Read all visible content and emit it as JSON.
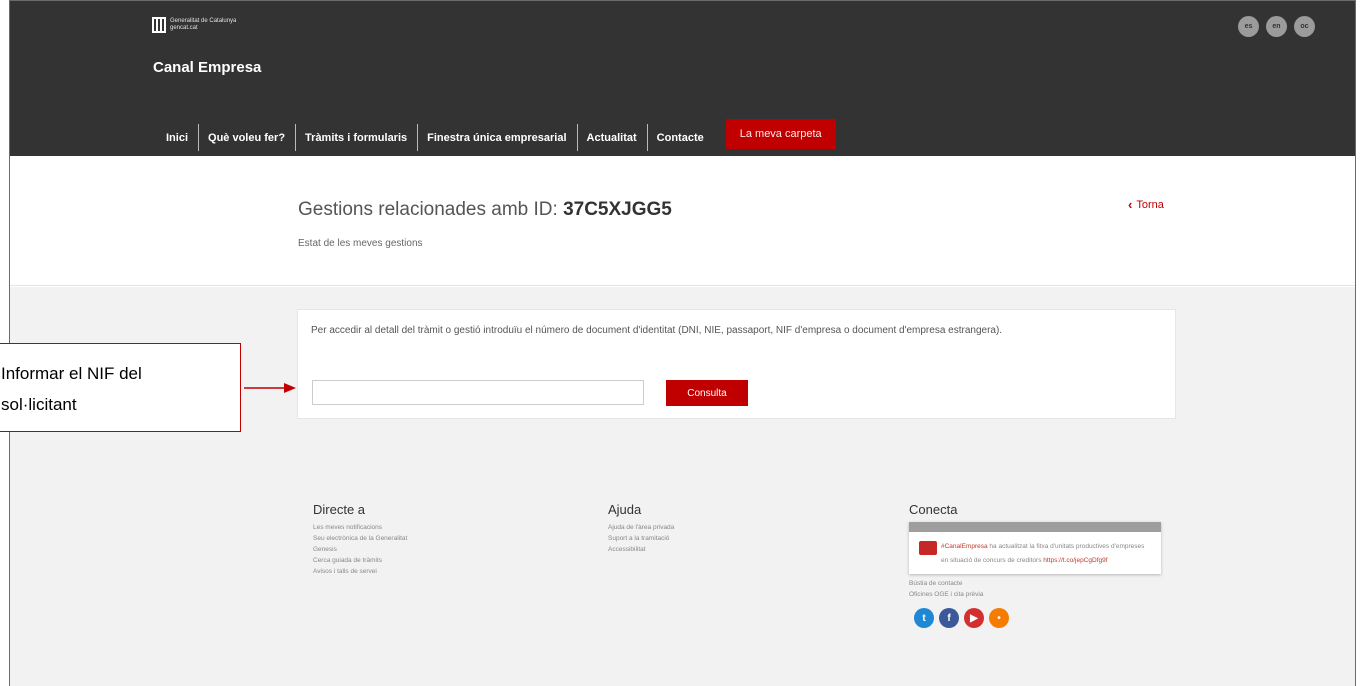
{
  "header": {
    "logo_text_line1": "Generalitat de Catalunya",
    "logo_text_line2": "gencat.cat",
    "site_title": "Canal Empresa",
    "languages": [
      "es",
      "en",
      "oc"
    ],
    "nav": {
      "items": [
        "Inici",
        "Què voleu fer?",
        "Tràmits i formularis",
        "Finestra única empresarial",
        "Actualitat",
        "Contacte"
      ],
      "active": "La meva carpeta"
    }
  },
  "title_section": {
    "title_prefix": "Gestions relacionades amb ID:",
    "id": "37C5XJGG5",
    "subtitle": "Estat de les meves gestions",
    "back_label": "Torna"
  },
  "query": {
    "instructions": "Per accedir al detall del tràmit o gestió introduïu el número de document d'identitat (DNI, NIE, passaport, NIF d'empresa o document d'empresa estrangera).",
    "input_value": "",
    "button_label": "Consulta"
  },
  "footer": {
    "directe": {
      "title": "Directe a",
      "links": [
        "Les meves notificacions",
        "Seu electrònica de la Generalitat",
        "Genesis",
        "Cerca guiada de tràmits",
        "Avisos i talls de servei"
      ]
    },
    "ajuda": {
      "title": "Ajuda",
      "links": [
        "Ajuda de l'àrea privada",
        "Suport a la tramitació",
        "Accessibilitat"
      ]
    },
    "conecta": {
      "title": "Conecta",
      "tweet_hashtag": "#CanalEmpresa",
      "tweet_text": "ha actualitzat la fitxa d'unitats productives d'empreses en situació de concurs de creditors",
      "tweet_link": "https://t.co/jepCgDfg9f",
      "links": [
        "Bústia de contacte",
        "Oficines OGE i cita prèvia"
      ]
    }
  },
  "annotation": {
    "line1": "Informar el NIF del",
    "line2": "sol·licitant"
  },
  "colors": {
    "header_bg": "#333333",
    "accent_red": "#c00000",
    "body_grey": "#f2f2f2"
  },
  "social_icons": [
    "twitter-icon",
    "facebook-icon",
    "youtube-icon",
    "rss-icon"
  ]
}
